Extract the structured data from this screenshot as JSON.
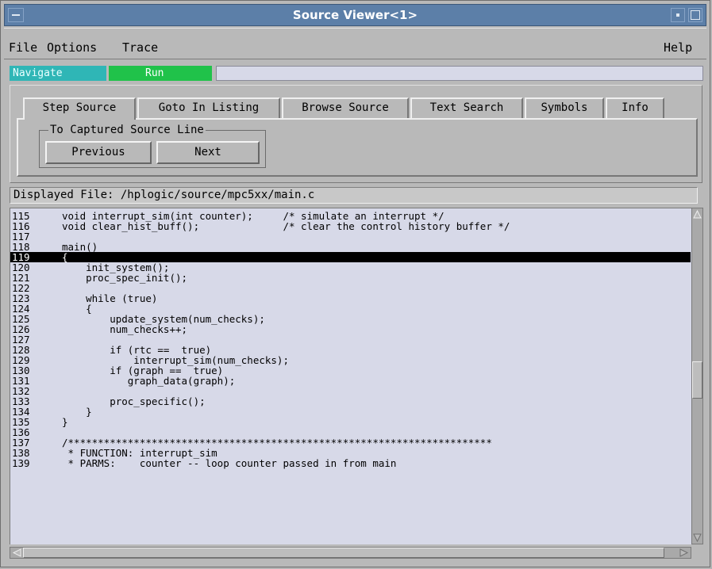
{
  "window": {
    "title": "Source Viewer<1>"
  },
  "menubar": {
    "items": [
      "File",
      "Options",
      "Trace"
    ],
    "help": "Help"
  },
  "toolbar": {
    "navigate_label": "Navigate",
    "run_label": "Run",
    "status_text": ""
  },
  "tabs": [
    {
      "label": "Step Source",
      "active": true
    },
    {
      "label": "Goto In Listing",
      "active": false
    },
    {
      "label": "Browse Source",
      "active": false
    },
    {
      "label": "Text Search",
      "active": false
    },
    {
      "label": "Symbols",
      "active": false
    },
    {
      "label": "Info",
      "active": false
    }
  ],
  "step_source": {
    "group_title": "To Captured Source Line",
    "previous_label": "Previous",
    "next_label": "Next"
  },
  "file": {
    "label": "Displayed File: /hplogic/source/mpc5xx/main.c"
  },
  "source": {
    "highlighted_line": "119",
    "lines": [
      {
        "num": "115",
        "code": "void interrupt_sim(int counter);     /* simulate an interrupt */"
      },
      {
        "num": "116",
        "code": "void clear_hist_buff();              /* clear the control history buffer */"
      },
      {
        "num": "117",
        "code": ""
      },
      {
        "num": "118",
        "code": "main()"
      },
      {
        "num": "119",
        "code": "{"
      },
      {
        "num": "120",
        "code": "    init_system();"
      },
      {
        "num": "121",
        "code": "    proc_spec_init();"
      },
      {
        "num": "122",
        "code": ""
      },
      {
        "num": "123",
        "code": "    while (true)"
      },
      {
        "num": "124",
        "code": "    {"
      },
      {
        "num": "125",
        "code": "        update_system(num_checks);"
      },
      {
        "num": "126",
        "code": "        num_checks++;"
      },
      {
        "num": "127",
        "code": ""
      },
      {
        "num": "128",
        "code": "        if (rtc ==  true)"
      },
      {
        "num": "129",
        "code": "            interrupt_sim(num_checks);"
      },
      {
        "num": "130",
        "code": "        if (graph ==  true)"
      },
      {
        "num": "131",
        "code": "           graph_data(graph);"
      },
      {
        "num": "132",
        "code": ""
      },
      {
        "num": "133",
        "code": "        proc_specific();"
      },
      {
        "num": "134",
        "code": "    }"
      },
      {
        "num": "135",
        "code": "}"
      },
      {
        "num": "136",
        "code": ""
      },
      {
        "num": "137",
        "code": "/***********************************************************************"
      },
      {
        "num": "138",
        "code": " * FUNCTION: interrupt_sim"
      },
      {
        "num": "139",
        "code": " * PARMS:    counter -- loop counter passed in from main"
      }
    ]
  },
  "scroll": {
    "vertical_position": 0.46,
    "horizontal_position": 0.0
  },
  "colors": {
    "titlebar": "#5c7fa8",
    "navigate": "#2fb6b6",
    "run": "#20c24a",
    "source_bg": "#d7d9e8",
    "window_bg": "#b9b9b9"
  },
  "icons": [
    "window-menu-icon",
    "minimize-icon",
    "maximize-icon",
    "scroll-up-arrow-icon",
    "scroll-down-arrow-icon",
    "scroll-left-arrow-icon",
    "scroll-right-arrow-icon"
  ]
}
